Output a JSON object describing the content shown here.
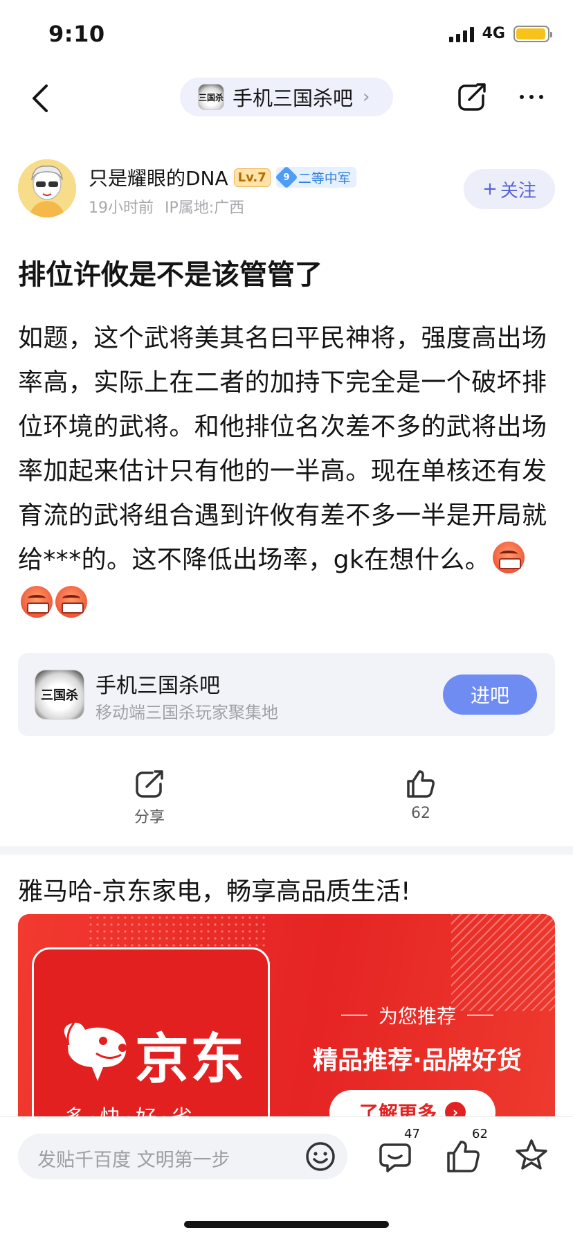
{
  "status": {
    "time": "9:10",
    "network": "4G",
    "battery_level": 0.95
  },
  "nav": {
    "forum_name": "手机三国杀吧",
    "forum_icon_text": "三国杀",
    "back_icon": "chevron-left-icon",
    "share_icon": "share-icon",
    "more_icon": "more-icon"
  },
  "author": {
    "name": "只是耀眼的DNA",
    "level": "Lv.7",
    "rank_number": "9",
    "rank_title": "二等中军",
    "time": "19小时前",
    "location": "IP属地:广西",
    "follow_label": "关注"
  },
  "post": {
    "title": "排位许攸是不是该管管了",
    "body": "如题，这个武将美其名曰平民神将，强度高出场率高，实际上在二者的加持下完全是一个破坏排位环境的武将。和他排位名次差不多的武将出场率加起来估计只有他的一半高。现在单核还有发育流的武将组合遇到许攸有差不多一半是开局就给***的。这不降低出场率，gk在想什么。",
    "emoji_count": 3
  },
  "forum_card": {
    "name": "手机三国杀吧",
    "desc": "移动端三国杀玩家聚集地",
    "icon_text": "三国杀",
    "enter_label": "进吧"
  },
  "actions": {
    "share_label": "分享",
    "like_count": "62"
  },
  "ad": {
    "title": "雅马哈-京东家电，畅享高品质生活!",
    "brand": "京东",
    "slogan": "多·快·好·省",
    "recommend": "为您推荐",
    "headline": "精品推荐·品牌好货",
    "more_label": "了解更多",
    "colors": {
      "primary": "#e52424",
      "text": "#ffffff"
    }
  },
  "bottom": {
    "placeholder": "发贴千百度 文明第一步",
    "comment_count": "47",
    "like_count": "62"
  },
  "colors": {
    "accent": "#5664d6",
    "enter_button": "#6e8cf2",
    "battery": "#f7c31a"
  }
}
